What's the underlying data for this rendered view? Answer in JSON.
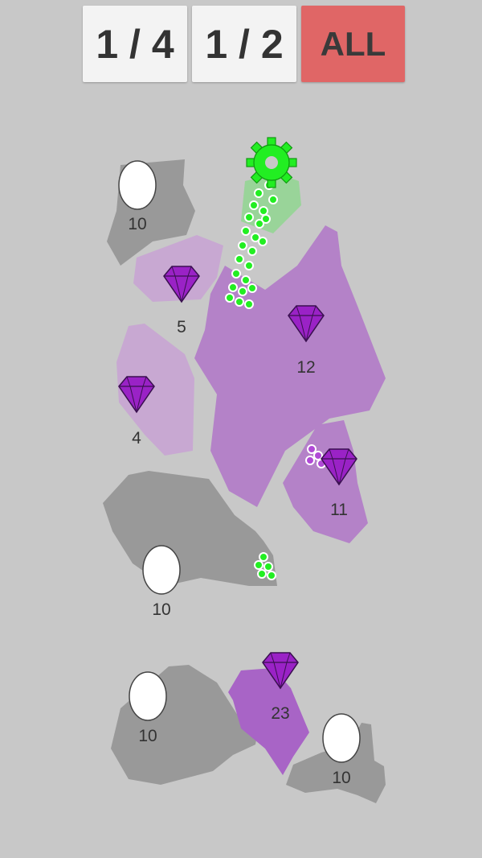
{
  "toolbar": {
    "quarter_label": "1 / 4",
    "half_label": "1 / 2",
    "all_label": "ALL"
  },
  "colors": {
    "background": "#c8c8c8",
    "neutral_region": "#999999",
    "purple_region": "#b482c8",
    "light_purple_region": "#c8a8d2",
    "player": "#22ee22",
    "gem": "#9a22c6",
    "all_button": "#e06666"
  },
  "gems": [
    {
      "value": "5"
    },
    {
      "value": "12"
    },
    {
      "value": "4"
    },
    {
      "value": "11"
    },
    {
      "value": "23"
    }
  ],
  "neutrals": [
    {
      "value": "10"
    },
    {
      "value": "10"
    },
    {
      "value": "10"
    },
    {
      "value": "10"
    }
  ],
  "icons": {
    "player_base": "gear-icon",
    "gem": "gem-icon",
    "neutral_base": "circle-icon"
  }
}
